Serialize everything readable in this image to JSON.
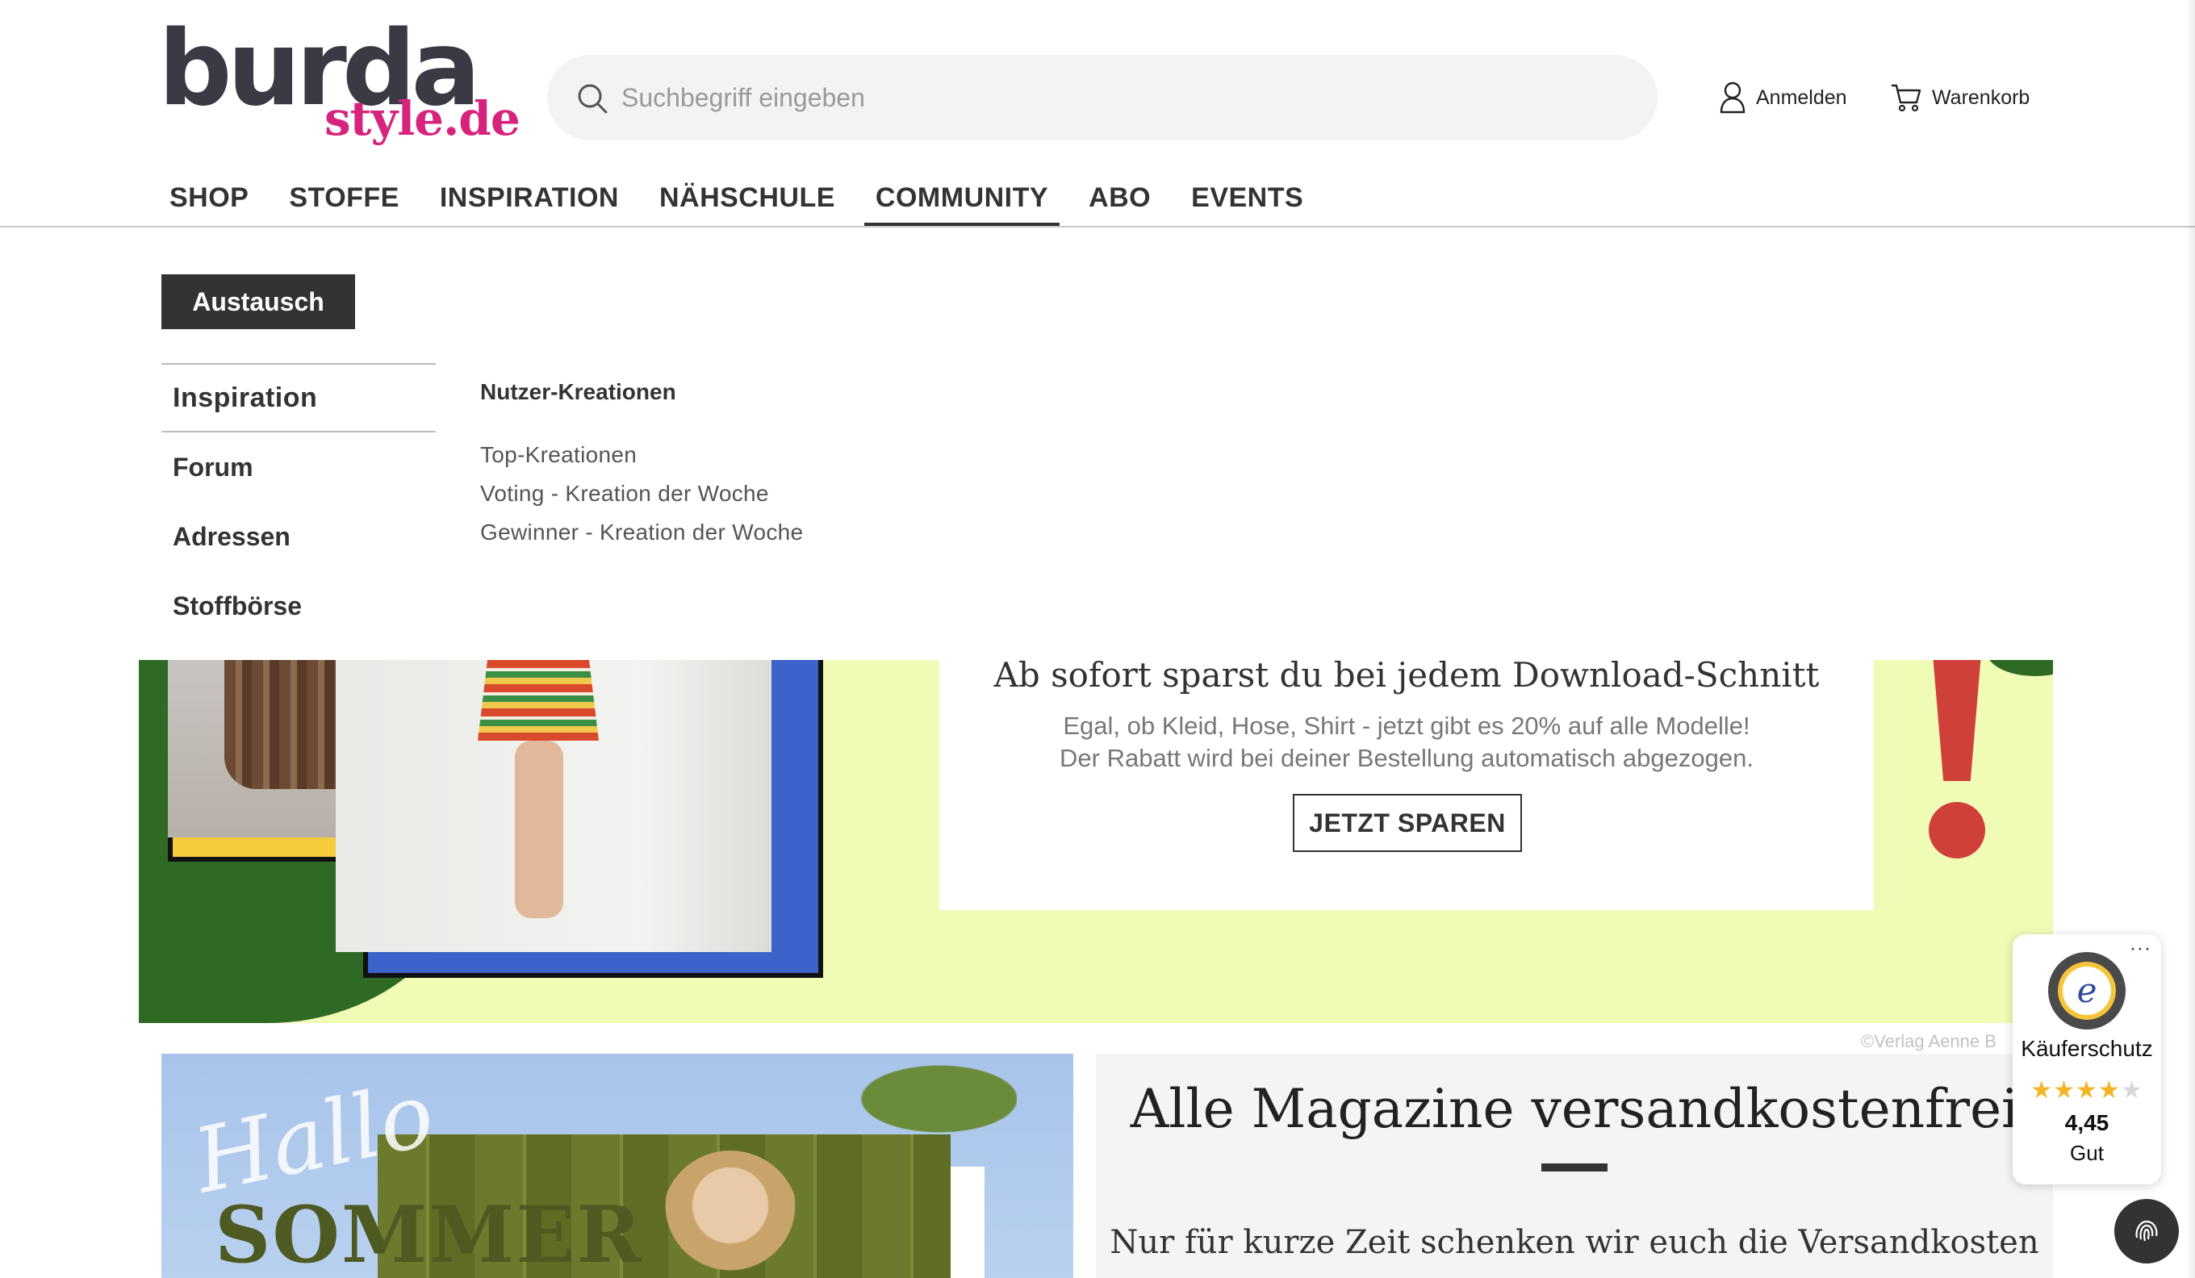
{
  "brand": {
    "name": "burda",
    "suffix": "style.de"
  },
  "search": {
    "placeholder": "Suchbegriff eingeben",
    "value": ""
  },
  "header": {
    "login_label": "Anmelden",
    "cart_label": "Warenkorb"
  },
  "nav": {
    "items": [
      {
        "label": "SHOP"
      },
      {
        "label": "STOFFE"
      },
      {
        "label": "INSPIRATION"
      },
      {
        "label": "NÄHSCHULE"
      },
      {
        "label": "COMMUNITY",
        "active": true
      },
      {
        "label": "ABO"
      },
      {
        "label": "EVENTS"
      }
    ]
  },
  "mega_menu": {
    "tab_label": "Austausch",
    "side_items": [
      {
        "label": "Inspiration",
        "active": true
      },
      {
        "label": "Forum"
      },
      {
        "label": "Adressen"
      },
      {
        "label": "Stoffbörse"
      }
    ],
    "sub_title": "Nutzer-Kreationen",
    "sub_links": [
      {
        "label": "Top-Kreationen"
      },
      {
        "label": "Voting - Kreation der Woche"
      },
      {
        "label": "Gewinner - Kreation der Woche"
      }
    ]
  },
  "banner": {
    "headline": "Ab sofort sparst du bei jedem Download-Schnitt",
    "text_line1": "Egal, ob Kleid, Hose, Shirt - jetzt gibt es 20% auf alle Modelle!",
    "text_line2": "Der Rabatt wird bei deiner Bestellung automatisch abgezogen.",
    "button_label": "JETZT SPAREN",
    "credit": "©Verlag Aenne B"
  },
  "summer_teaser": {
    "script_text": "Hallo",
    "title": "SOMMER"
  },
  "magazine_teaser": {
    "title": "Alle Magazine versandkostenfrei",
    "text": "Nur für kurze Zeit schenken wir euch die Versandkosten"
  },
  "trusted_shops": {
    "menu_glyph": "···",
    "label": "Käuferschutz",
    "stars": "★★★★",
    "half_star": "★",
    "rating": 4.45,
    "score": "4,45",
    "grade": "Gut"
  },
  "colors": {
    "brand_dark": "#3a3a44",
    "brand_pink": "#d6237e",
    "banner_bg": "#f0fbb6",
    "accent_red": "#d0403a"
  }
}
